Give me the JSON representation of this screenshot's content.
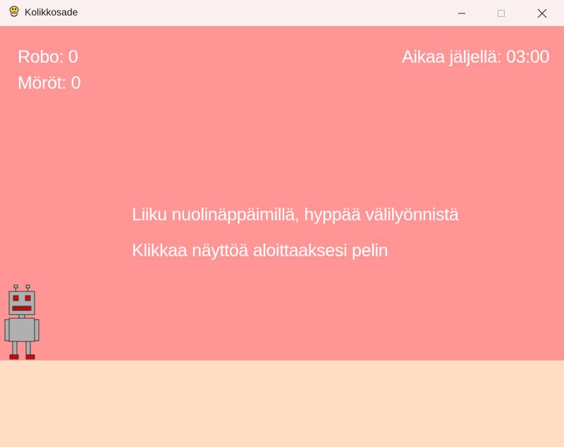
{
  "window": {
    "title": "Kolikkosade",
    "icon": "python-snake-icon"
  },
  "hud": {
    "robo": "Robo: 0",
    "morot": "Möröt: 0",
    "timer": "Aikaa jäljellä: 03:00"
  },
  "messages": {
    "instructions": "Liiku nuolinäppäimillä, hyppää välilyönnistä",
    "start": "Klikkaa näyttöä aloittaaksesi pelin"
  },
  "colors": {
    "sky": "#ff9595",
    "ground": "#ffdcc4",
    "text": "#ffffff",
    "robot_body": "#b0b0b0",
    "robot_accent": "#e00000"
  },
  "player": {
    "icon": "robot-icon"
  }
}
